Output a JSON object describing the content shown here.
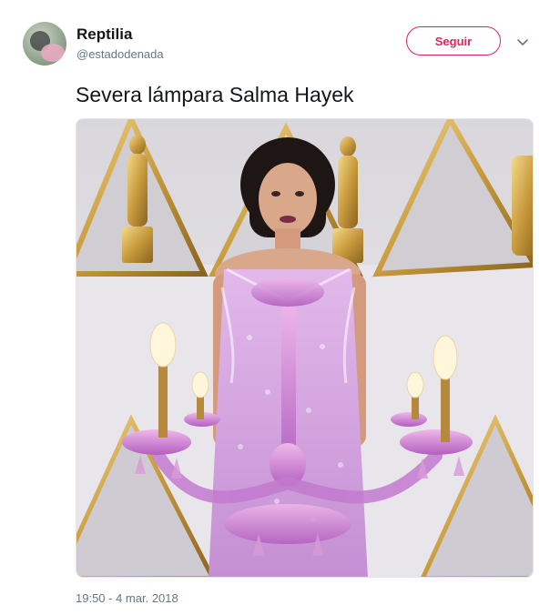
{
  "user": {
    "name": "Reptilia",
    "handle": "@estadodenada"
  },
  "actions": {
    "follow_label": "Seguir",
    "more_icon": "chevron-down-icon"
  },
  "tweet": {
    "text": "Severa lámpara Salma Hayek",
    "timestamp": "19:50 - 4 mar. 2018"
  },
  "colors": {
    "accent": "#e0245e",
    "text_primary": "#14171a",
    "text_secondary": "#657786"
  }
}
